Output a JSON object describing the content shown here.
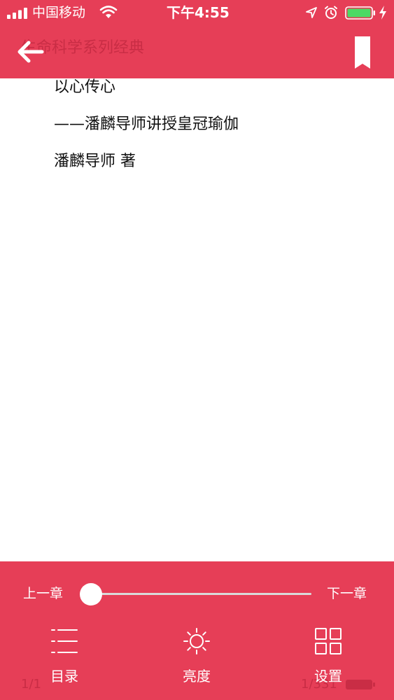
{
  "status_bar": {
    "carrier": "中国移动",
    "time": "下午4:55"
  },
  "nav": {
    "book_series": "生命科学系列经典"
  },
  "content": {
    "lines": [
      "以心传心",
      "——潘麟导师讲授皇冠瑜伽",
      "潘麟导师 著"
    ]
  },
  "bottom_bar": {
    "prev_chapter": "上一章",
    "next_chapter": "下一章",
    "progress_fraction": 0.0,
    "page_indicator_left": "1/1",
    "page_indicator_right": "1/331",
    "tabs": [
      {
        "label": "目录",
        "icon": "list-icon"
      },
      {
        "label": "亮度",
        "icon": "sun-icon"
      },
      {
        "label": "设置",
        "icon": "grid-icon"
      }
    ]
  },
  "colors": {
    "accent": "#e63e57",
    "text": "#111111",
    "background": "#ffffff"
  }
}
